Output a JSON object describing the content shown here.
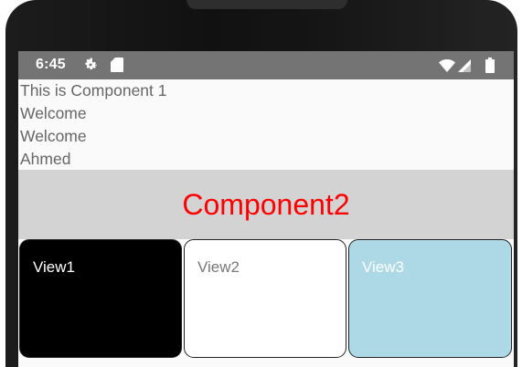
{
  "status_bar": {
    "time": "6:45",
    "icons": [
      "gear-icon",
      "sd-card-icon",
      "wifi-icon",
      "signal-icon",
      "battery-icon"
    ]
  },
  "component1": {
    "lines": [
      "This is Component 1",
      "Welcome",
      "Welcome",
      "Ahmed"
    ]
  },
  "component2": {
    "title": "Component2",
    "title_color": "#ff0000",
    "background": "#d3d3d3"
  },
  "views": [
    {
      "label": "View1",
      "background": "#000000"
    },
    {
      "label": "View2",
      "background": "#ffffff"
    },
    {
      "label": "View3",
      "background": "#add8e6"
    }
  ]
}
